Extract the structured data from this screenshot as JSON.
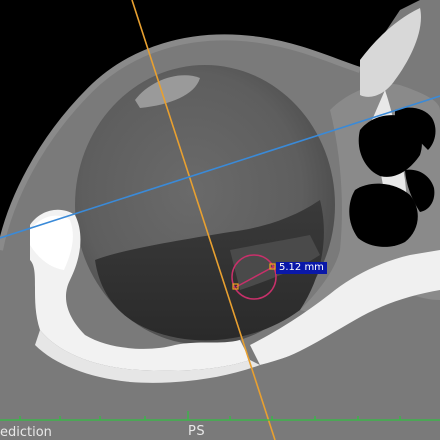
{
  "viewer": {
    "orientation_label": "PS",
    "series_label": "ediction",
    "measurement": {
      "text": "5.12 mm",
      "color": "#c8306a",
      "handle_color": "#f0a020",
      "label_bg": "#0a18a8"
    },
    "reference_lines": {
      "orange_color": "#e8a030",
      "blue_color": "#3a8ad8",
      "ruler_color": "#30c040"
    }
  }
}
